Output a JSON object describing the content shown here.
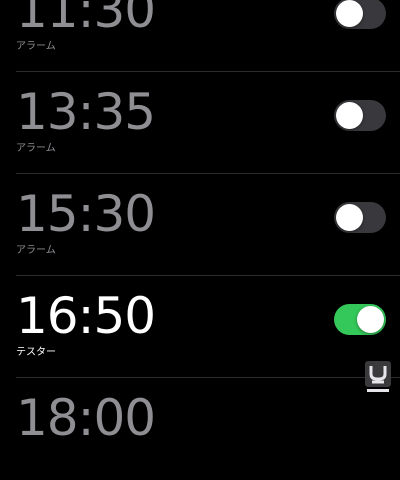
{
  "alarms": [
    {
      "time": "11:30",
      "label": "アラーム",
      "enabled": false
    },
    {
      "time": "13:35",
      "label": "アラーム",
      "enabled": false
    },
    {
      "time": "15:30",
      "label": "アラーム",
      "enabled": false
    },
    {
      "time": "16:50",
      "label": "テスター",
      "enabled": true
    },
    {
      "time": "18:00",
      "label": "",
      "enabled": false
    }
  ],
  "colors": {
    "background": "#000000",
    "inactive_text": "#8e8e93",
    "active_text": "#ffffff",
    "toggle_on": "#34c759",
    "toggle_off": "#39393d",
    "separator": "#2c2c2e"
  },
  "watermark": {
    "icon": "watermark-logo-icon"
  }
}
